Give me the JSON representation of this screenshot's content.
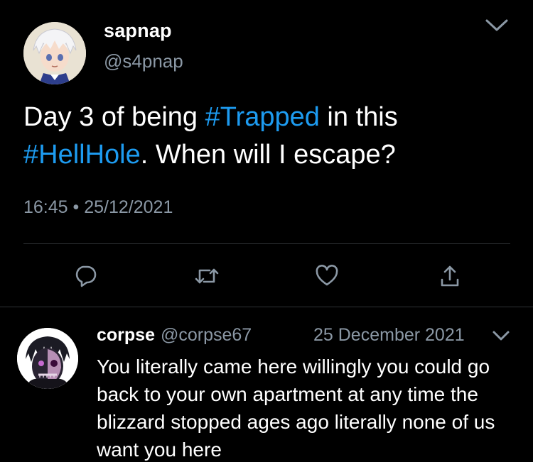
{
  "tweet": {
    "display_name": "sapnap",
    "handle": "@s4pnap",
    "text_parts": [
      {
        "text": "Day 3 of being ",
        "type": "plain"
      },
      {
        "text": "#Trapped",
        "type": "hashtag"
      },
      {
        "text": " in this ",
        "type": "plain"
      },
      {
        "text": "#HellHole",
        "type": "hashtag"
      },
      {
        "text": ". When will I escape?",
        "type": "plain"
      }
    ],
    "time": "16:45",
    "separator": "•",
    "date": "25/12/2021"
  },
  "actions": [
    {
      "name": "reply-icon"
    },
    {
      "name": "retweet-icon"
    },
    {
      "name": "like-icon"
    },
    {
      "name": "share-icon"
    }
  ],
  "reply": {
    "display_name": "corpse",
    "handle": "@corpse67",
    "date": "25 December 2021",
    "text": "You literally came here willingly you could go back to your own apartment at any time the blizzard stopped ages ago literally none of us want you here"
  },
  "colors": {
    "background": "#000000",
    "text": "#ffffff",
    "secondary": "#8b98a5",
    "hashtag": "#1d9bf0",
    "divider": "#2f3336"
  }
}
